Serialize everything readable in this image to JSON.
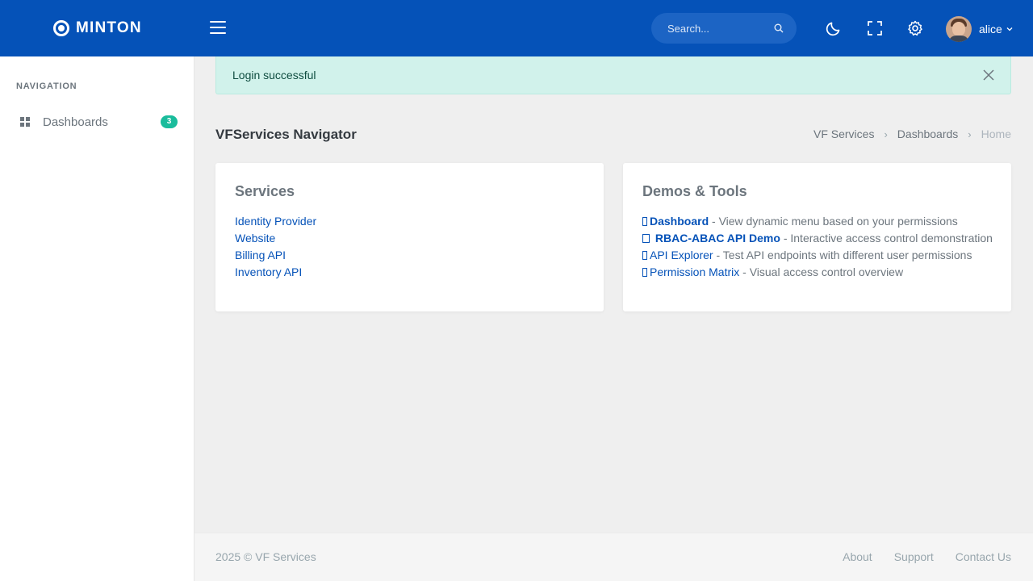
{
  "brand": {
    "name": "MINTON"
  },
  "topbar": {
    "search_placeholder": "Search...",
    "icons": [
      "menu-icon",
      "search-icon",
      "moon-icon",
      "fullscreen-icon",
      "gear-icon",
      "chevron-down-icon"
    ],
    "username": "alice"
  },
  "sidebar": {
    "section_title": "NAVIGATION",
    "items": [
      {
        "label": "Dashboards",
        "badge": "3",
        "icon": "dashboard-icon"
      }
    ]
  },
  "alert": {
    "message": "Login successful"
  },
  "page": {
    "title": "VFServices Navigator",
    "breadcrumb": [
      "VF Services",
      "Dashboards",
      "Home"
    ]
  },
  "services": {
    "title": "Services",
    "links": [
      "Identity Provider",
      "Website",
      "Billing API",
      "Inventory API"
    ]
  },
  "demos": {
    "title": "Demos & Tools",
    "items": [
      {
        "label": "Dashboard",
        "desc": " - View dynamic menu based on your permissions"
      },
      {
        "label": "RBAC-ABAC API Demo",
        "desc": " - Interactive access control demonstration"
      },
      {
        "label": "API Explorer",
        "desc": " - Test API endpoints with different user permissions"
      },
      {
        "label": "Permission Matrix",
        "desc": " - Visual access control overview"
      }
    ]
  },
  "footer": {
    "copyright": "2025 © VF Services",
    "links": [
      "About",
      "Support",
      "Contact Us"
    ]
  },
  "colors": {
    "primary": "#0552b8",
    "badge": "#1abc9c",
    "alert_bg": "#d1f2eb"
  }
}
